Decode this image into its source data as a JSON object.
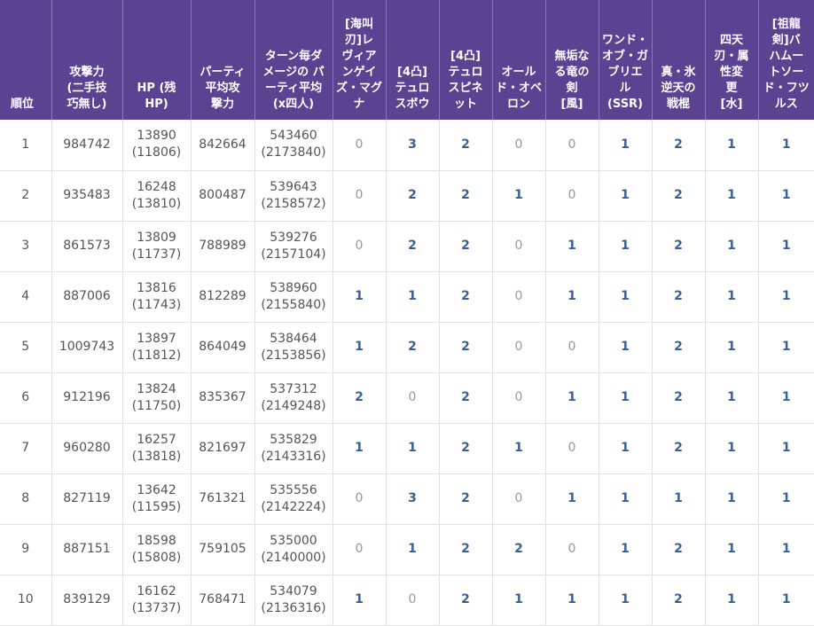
{
  "headers": [
    "順位",
    "攻撃力\n(二手技\n巧無し)",
    "HP (残\nHP)",
    "パーティ\n平均攻\n撃力",
    "ターン毎ダ\nメージの パ\nーティ平均\n(x四人)",
    "[海叫\n刃]レ\nヴィア\nンゲイ\nズ・マグ\nナ",
    "[4凸]\nテュロ\nスボウ",
    "[4凸]\nテュロ\nスピネ\nット",
    "オール\nド・オベ\nロン",
    "無垢な\nる竜の\n剣\n[風]",
    "ワンド・\nオブ・ガ\nブリエ\nル\n(SSR)",
    "真・氷\n逆天の\n戦棍",
    "四天\n刃・属\n性変\n更\n[水]",
    "[祖龍\n剣]バ\nハムー\nトソー\nド・フツ\nルス"
  ],
  "rows": [
    {
      "rank": "1",
      "atk": "984742",
      "hp1": "13890",
      "hp2": "(11806)",
      "pavg": "842664",
      "dmg1": "543460",
      "dmg2": "(2173840)",
      "counts": [
        "0",
        "3",
        "2",
        "0",
        "0",
        "1",
        "2",
        "1",
        "1"
      ]
    },
    {
      "rank": "2",
      "atk": "935483",
      "hp1": "16248",
      "hp2": "(13810)",
      "pavg": "800487",
      "dmg1": "539643",
      "dmg2": "(2158572)",
      "counts": [
        "0",
        "2",
        "2",
        "1",
        "0",
        "1",
        "2",
        "1",
        "1"
      ]
    },
    {
      "rank": "3",
      "atk": "861573",
      "hp1": "13809",
      "hp2": "(11737)",
      "pavg": "788989",
      "dmg1": "539276",
      "dmg2": "(2157104)",
      "counts": [
        "0",
        "2",
        "2",
        "0",
        "1",
        "1",
        "2",
        "1",
        "1"
      ]
    },
    {
      "rank": "4",
      "atk": "887006",
      "hp1": "13816",
      "hp2": "(11743)",
      "pavg": "812289",
      "dmg1": "538960",
      "dmg2": "(2155840)",
      "counts": [
        "1",
        "1",
        "2",
        "0",
        "1",
        "1",
        "2",
        "1",
        "1"
      ]
    },
    {
      "rank": "5",
      "atk": "1009743",
      "hp1": "13897",
      "hp2": "(11812)",
      "pavg": "864049",
      "dmg1": "538464",
      "dmg2": "(2153856)",
      "counts": [
        "1",
        "2",
        "2",
        "0",
        "0",
        "1",
        "2",
        "1",
        "1"
      ]
    },
    {
      "rank": "6",
      "atk": "912196",
      "hp1": "13824",
      "hp2": "(11750)",
      "pavg": "835367",
      "dmg1": "537312",
      "dmg2": "(2149248)",
      "counts": [
        "2",
        "0",
        "2",
        "0",
        "1",
        "1",
        "2",
        "1",
        "1"
      ]
    },
    {
      "rank": "7",
      "atk": "960280",
      "hp1": "16257",
      "hp2": "(13818)",
      "pavg": "821697",
      "dmg1": "535829",
      "dmg2": "(2143316)",
      "counts": [
        "1",
        "1",
        "2",
        "1",
        "0",
        "1",
        "2",
        "1",
        "1"
      ]
    },
    {
      "rank": "8",
      "atk": "827119",
      "hp1": "13642",
      "hp2": "(11595)",
      "pavg": "761321",
      "dmg1": "535556",
      "dmg2": "(2142224)",
      "counts": [
        "0",
        "3",
        "2",
        "0",
        "1",
        "1",
        "1",
        "1",
        "1"
      ]
    },
    {
      "rank": "9",
      "atk": "887151",
      "hp1": "18598",
      "hp2": "(15808)",
      "pavg": "759105",
      "dmg1": "535000",
      "dmg2": "(2140000)",
      "counts": [
        "0",
        "1",
        "2",
        "2",
        "0",
        "1",
        "2",
        "1",
        "1"
      ]
    },
    {
      "rank": "10",
      "atk": "839129",
      "hp1": "16162",
      "hp2": "(13737)",
      "pavg": "768471",
      "dmg1": "534079",
      "dmg2": "(2136316)",
      "counts": [
        "1",
        "0",
        "2",
        "1",
        "1",
        "1",
        "2",
        "1",
        "1"
      ]
    }
  ],
  "colors": {
    "header_bg": "#5b4392",
    "count_color": "#3a5f92",
    "zero_color": "#999999",
    "text_color": "#555555"
  }
}
